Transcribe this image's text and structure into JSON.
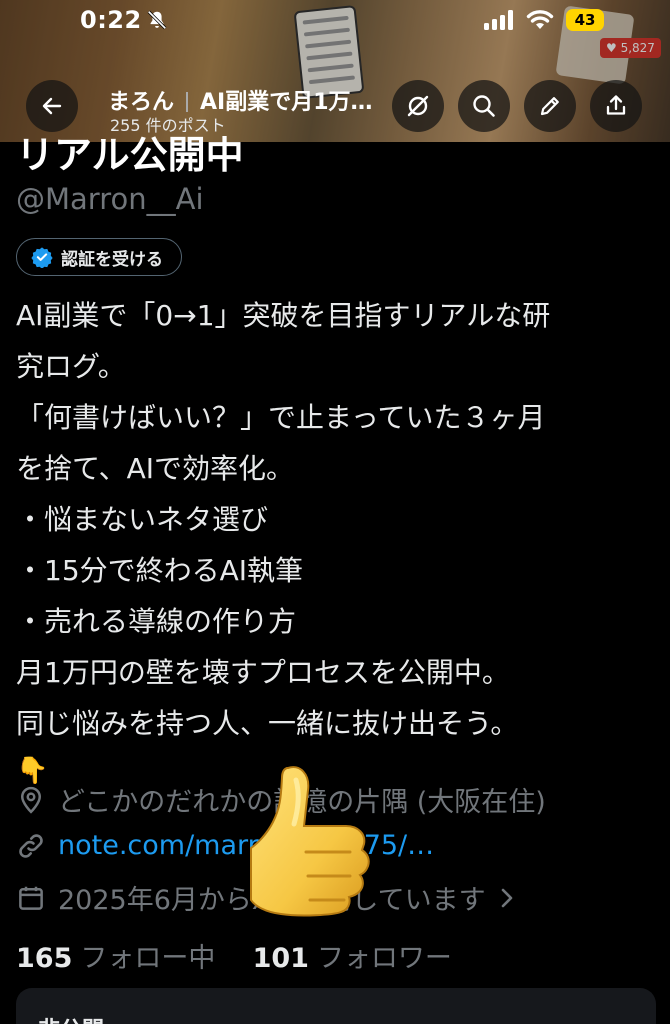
{
  "status_bar": {
    "time": "0:22",
    "battery": "43"
  },
  "banner": {
    "note_lines": 6,
    "heart_count": "♥ 5,827"
  },
  "nav": {
    "name": "まろん",
    "pinned_title": "AI副業で月1万…",
    "post_count": "255 件のポスト"
  },
  "profile": {
    "name_partial": "リアル公開中",
    "handle": "@Marron__Ai",
    "verify_label": "認証を受ける",
    "bio_lines": [
      "AI副業で「0→1」突破を目指すリアルな研",
      "究ログ。",
      "「何書けばいい？」で止まっていた３ヶ月",
      "を捨て、AIで効率化。",
      "・悩まないネタ選び",
      "・15分で終わるAI執筆",
      "・売れる導線の作り方",
      "月1万円の壁を壊すプロセスを公開中。",
      "同じ悩みを持つ人、一緒に抜け出そう。"
    ],
    "bio_emoji": "👇",
    "location": "どこかのだれかの記憶の片隅 (大阪在住)",
    "website": "note.com/marron_ai3675/…",
    "joined": "2025年6月からXを利用しています",
    "following_count": "165",
    "following_label": "フォロー中",
    "followers_count": "101",
    "followers_label": "フォロワー",
    "privacy_card_label": "非公開"
  },
  "overlay": {
    "sticker": "thumbs-up"
  },
  "colors": {
    "link": "#1d9bf0",
    "muted": "#71767b",
    "text": "#e7e9ea",
    "verified": "#1d9bf0",
    "battery": "#ffd400"
  }
}
